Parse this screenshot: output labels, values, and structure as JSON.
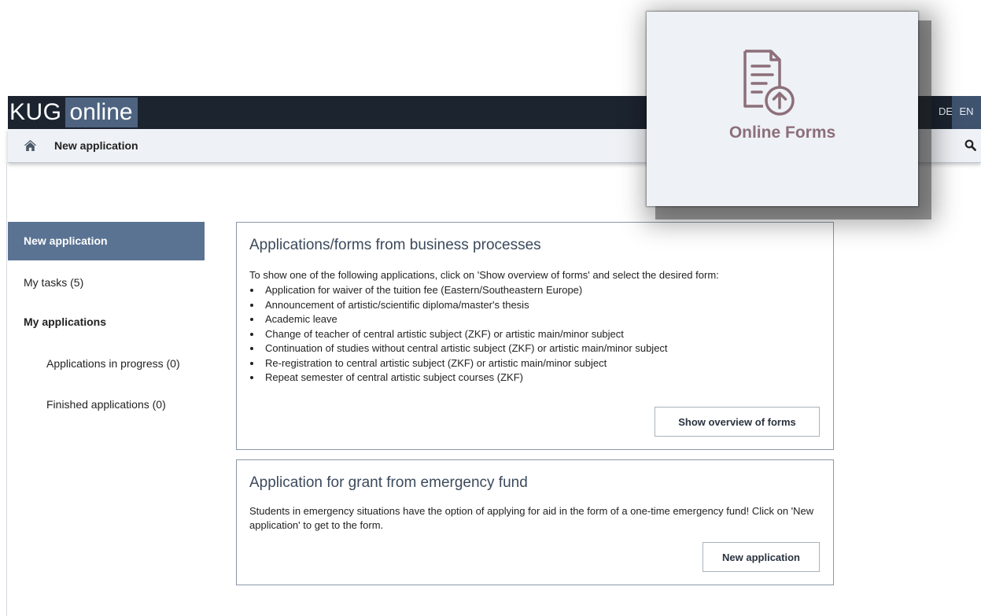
{
  "header": {
    "logo_part1": "KUG",
    "logo_part2": "online",
    "lang_de": "DE",
    "lang_en": "EN"
  },
  "breadcrumb": {
    "current": "New application",
    "home_icon": "home-icon",
    "search_icon": "search-icon"
  },
  "sidebar": {
    "active": "New application",
    "tasks": "My tasks (5)",
    "my_applications": "My applications",
    "in_progress": "Applications in progress (0)",
    "finished": "Finished applications (0)"
  },
  "card1": {
    "title": "Applications/forms from business processes",
    "intro": "To show one of the following applications, click on 'Show overview of forms' and select the desired form:",
    "items": [
      "Application for waiver of the tuition fee (Eastern/Southeastern Europe)",
      "Announcement of artistic/scientific diploma/master's thesis",
      "Academic leave",
      "Change of teacher of central artistic subject (ZKF) or artistic main/minor subject",
      "Continuation of studies without central artistic subject (ZKF) or artistic main/minor subject",
      "Re-registration to central artistic subject (ZKF) or artistic main/minor subject",
      "Repeat semester of central artistic subject courses (ZKF)"
    ],
    "button": "Show overview of forms"
  },
  "card2": {
    "title": "Application for grant from emergency fund",
    "text": "Students in emergency situations have the option of applying for aid in the form of a one-time emergency fund! Click on 'New application' to get to the form.",
    "button": "New application"
  },
  "popup": {
    "label": "Online Forms",
    "icon": "document-upload-icon"
  },
  "colors": {
    "topbar": "#1c2430",
    "logo_accent": "#4d6380",
    "sidebar_active": "#5a7393",
    "popup_label": "#8c6f78"
  }
}
